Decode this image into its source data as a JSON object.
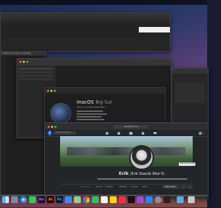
{
  "ps_window": {
    "title": "Untitled-1 @ 66.7% (RGB/8)"
  },
  "about_mac": {
    "os_name": "macOS",
    "os_release": "Big Sur",
    "version": "Version 11.0 Beta (20A5384c)"
  },
  "facebook": {
    "url": "facebook.com",
    "search_placeholder": "Search Facebook",
    "cover_button": "Edit Cover Photo",
    "profile_name": "Erik",
    "profile_alt_name": "(Erik Doenik iNtsi E)",
    "tabs": [
      "Timeline",
      "About",
      "Friends",
      "Photos",
      "Archive",
      "More"
    ],
    "edit_profile": "Edit Profile"
  },
  "dock": {
    "apps": [
      "Finder",
      "Launchpad",
      "Safari",
      "Messages",
      "Mail",
      "Maps",
      "Photos",
      "FaceTime",
      "Calendar",
      "Contacts",
      "Reminders",
      "Notes",
      "Music",
      "Podcasts",
      "TV",
      "App Store",
      "System Preferences",
      "Terminal",
      "Trash"
    ],
    "labels": [
      "Ps",
      "Ai",
      "An"
    ]
  },
  "colors": {
    "facebook_blue": "#1877f2",
    "ps_blue": "#31a8ff"
  }
}
